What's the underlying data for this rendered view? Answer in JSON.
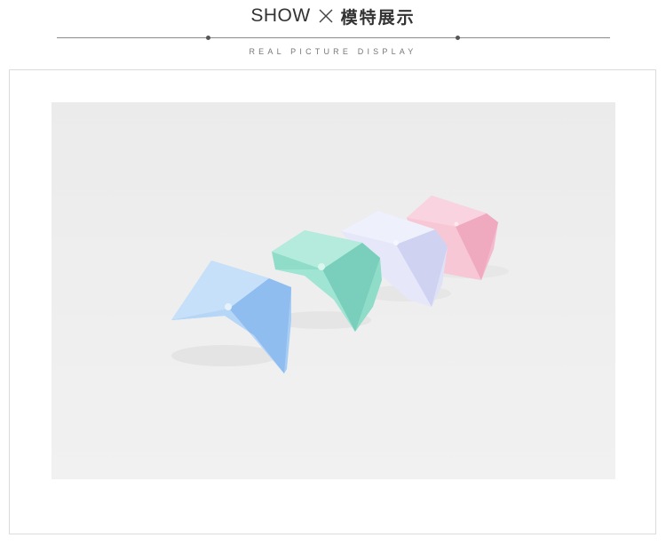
{
  "header": {
    "title_en": "SHOW",
    "title_separator_icon": "cross-icon",
    "title_zh": "模特展示",
    "subtitle": "REAL PICTURE DISPLAY"
  },
  "photo": {
    "subject": "folded-paper-cups",
    "colors": {
      "blue": "#a9cff5",
      "mint": "#93e0cf",
      "lavender": "#e2e4f8",
      "pink": "#f6c2d2",
      "background": "#ececec"
    }
  }
}
